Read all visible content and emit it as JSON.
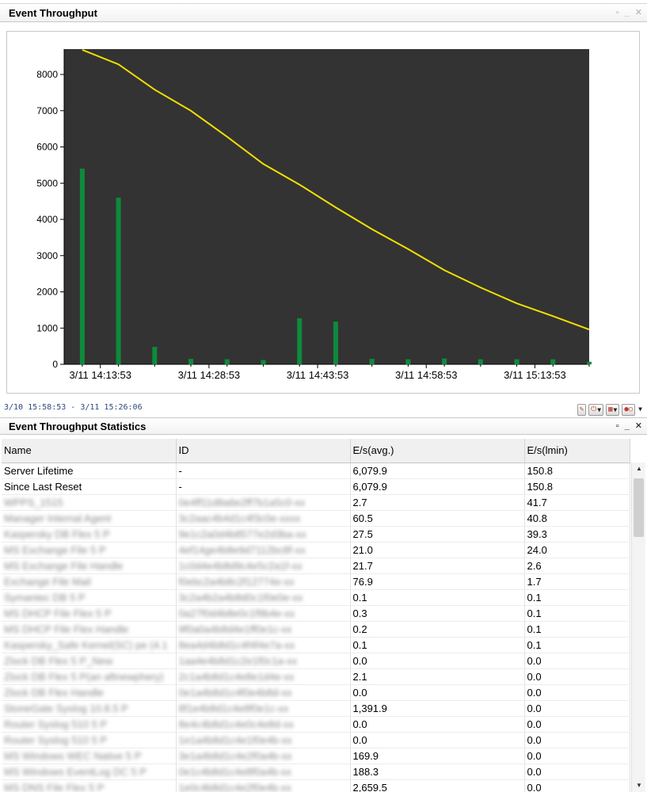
{
  "panels": {
    "chart_title": "Event Throughput",
    "stats_title": "Event Throughput Statistics"
  },
  "time_range": "3/10 15:58:53 - 3/11 15:26:06",
  "window_controls": {
    "restore": "▫",
    "minimize": "_",
    "close": "✕"
  },
  "icons": {
    "chart_toolbar": [
      "eraser-icon",
      "power-icon",
      "columns-icon",
      "record-icon"
    ]
  },
  "colors": {
    "chart_bg": "#333333",
    "bar": "#0e8a3c",
    "line": "#f3e000"
  },
  "chart_data": {
    "type": "bar",
    "yticks": [
      0,
      1000,
      2000,
      3000,
      4000,
      5000,
      6000,
      7000,
      8000
    ],
    "ylim": [
      0,
      8700
    ],
    "xlim": [
      0,
      14.5
    ],
    "xticks": [
      {
        "x": 1,
        "label": "3/11 14:13:53"
      },
      {
        "x": 4,
        "label": "3/11 14:28:53"
      },
      {
        "x": 7,
        "label": "3/11 14:43:53"
      },
      {
        "x": 10,
        "label": "3/11 14:58:53"
      },
      {
        "x": 13,
        "label": "3/11 15:13:53"
      }
    ],
    "series": [
      {
        "type": "bar",
        "x": [
          0.5,
          1.5,
          2.5,
          3.5,
          4.5,
          5.5,
          6.5,
          7.5,
          8.5,
          9.5,
          10.5,
          11.5,
          12.5,
          13.5,
          14.5
        ],
        "values": [
          5400,
          4600,
          480,
          150,
          140,
          120,
          1270,
          1180,
          150,
          140,
          160,
          140,
          140,
          140,
          70
        ]
      },
      {
        "type": "line",
        "x": [
          0.5,
          1.5,
          2.5,
          3.5,
          4.5,
          5.5,
          6.5,
          7.5,
          8.5,
          9.5,
          10.5,
          11.5,
          12.5,
          13.5,
          14.5
        ],
        "values": [
          8680,
          8280,
          7580,
          7000,
          6280,
          5530,
          4960,
          4330,
          3730,
          3180,
          2600,
          2120,
          1680,
          1330,
          960
        ]
      }
    ]
  },
  "table": {
    "columns": [
      "Name",
      "ID",
      "E/s(avg.)",
      "E/s(lmin)"
    ],
    "rows": [
      {
        "name": "Server Lifetime",
        "id": "-",
        "avg": "6,079.9",
        "lmin": "150.8"
      },
      {
        "name": "Since Last Reset",
        "id": "-",
        "avg": "6,079.9",
        "lmin": "150.8"
      },
      {
        "name": "WPPS_1515",
        "id": "0e4ff11d8a6e2ff7b1a5c0-xx",
        "avg": "2.7",
        "lmin": "41.7",
        "blur": true
      },
      {
        "name": "Manager Internal Agent",
        "id": "3c2aac4b4d1c4f3c0e-xxxx",
        "avg": "60.5",
        "lmin": "40.8",
        "blur": true
      },
      {
        "name": "Kaspersky DB Flex 5 P",
        "id": "9e1c2a0d4b8577e2d3ba-xx",
        "avg": "27.5",
        "lmin": "39.3",
        "blur": true
      },
      {
        "name": "MS Exchange File 5 P",
        "id": "4ef14ge4b8e9d7112bc8f-xx",
        "avg": "21.0",
        "lmin": "24.0",
        "blur": true
      },
      {
        "name": "MS Exchange File Handle",
        "id": "1c0d4e4b8d9c4e5c2a1f-xx",
        "avg": "21.7",
        "lmin": "2.6",
        "blur": true
      },
      {
        "name": "Exchange File Mail",
        "id": "f0ebc2a4b8c2f12774e-xx",
        "avg": "76.9",
        "lmin": "1.7",
        "blur": true
      },
      {
        "name": "Symantec DB 5 P",
        "id": "3c2a4b2a4b8d0c1f0e0e-xx",
        "avg": "0.1",
        "lmin": "0.1",
        "blur": true
      },
      {
        "name": "MS DHCP File Flex 5 P",
        "id": "0a27f0d4b8e0c1f9b4e-xx",
        "avg": "0.3",
        "lmin": "0.1",
        "blur": true
      },
      {
        "name": "MS DHCP File Flex Handle",
        "id": "9f0a0a4b8d4e1ff0e1c-xx",
        "avg": "0.2",
        "lmin": "0.1",
        "blur": true
      },
      {
        "name": "Kaspersky_Safe Kernel(SC) pe (4.1",
        "id": "8ea4d4b8d1c4f4f4e7a-xx",
        "avg": "0.1",
        "lmin": "0.1",
        "blur": true
      },
      {
        "name": "Zlock DB Flex 5 P_New",
        "id": "1aa4e4b8d1c2e1f0c1a-xx",
        "avg": "0.0",
        "lmin": "0.0",
        "blur": true
      },
      {
        "name": "Zlock DB Flex 5 P(an aftnewphery)",
        "id": "2c1a4b8d1c4e8e1d4e-xx",
        "avg": "2.1",
        "lmin": "0.0",
        "blur": true
      },
      {
        "name": "Zlock DB Flex Handle",
        "id": "0e1a4b8d1c4f0e4b8d-xx",
        "avg": "0.0",
        "lmin": "0.0",
        "blur": true
      },
      {
        "name": "StoneGate Syslog 10.8.5 P",
        "id": "8f1e4b8d1c4e8f0e1c-xx",
        "avg": "1,391.9",
        "lmin": "0.0",
        "blur": true
      },
      {
        "name": "Router Syslog 510 5 P",
        "id": "8e4c4b8d1c4e0c4e8d-xx",
        "avg": "0.0",
        "lmin": "0.0",
        "blur": true
      },
      {
        "name": "Router Syslog 510 5 P",
        "id": "1e1a4b8d1c4e1f0e4b-xx",
        "avg": "0.0",
        "lmin": "0.0",
        "blur": true
      },
      {
        "name": "MS Windows WEC Native 5 P",
        "id": "3e1a4b8d1c4e2f0a4b-xx",
        "avg": "169.9",
        "lmin": "0.0",
        "blur": true
      },
      {
        "name": "MS Windows EventLog DC 5 P",
        "id": "0e1c4b8d1c4e8f0a4b-xx",
        "avg": "188.3",
        "lmin": "0.0",
        "blur": true
      },
      {
        "name": "MS DNS File Flex 5 P",
        "id": "1e0c4b8d1c4e2f0e4b-xx",
        "avg": "2,659.5",
        "lmin": "0.0",
        "blur": true
      }
    ]
  }
}
